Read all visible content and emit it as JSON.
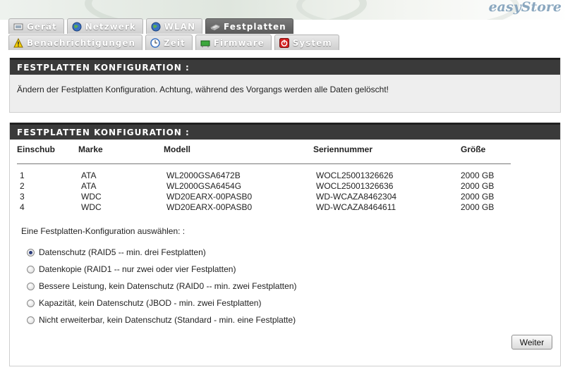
{
  "brand": {
    "logo_text": "easyStore"
  },
  "tabs_row1": [
    {
      "label": "Gerät",
      "icon": "device-icon"
    },
    {
      "label": "Netzwerk",
      "icon": "globe-icon"
    },
    {
      "label": "WLAN",
      "icon": "globe-icon"
    },
    {
      "label": "Festplatten",
      "icon": "disk-icon",
      "active": true
    }
  ],
  "tabs_row2": [
    {
      "label": "Benachrichtigungen",
      "icon": "warning-icon"
    },
    {
      "label": "Zeit",
      "icon": "clock-icon"
    },
    {
      "label": "Firmware",
      "icon": "firmware-icon"
    },
    {
      "label": "System",
      "icon": "power-icon"
    }
  ],
  "section1": {
    "title": "FESTPLATTEN KONFIGURATION :",
    "message": "Ändern der Festplatten Konfiguration. Achtung, während des Vorgangs werden alle Daten gelöscht!"
  },
  "section2": {
    "title": "FESTPLATTEN KONFIGURATION :",
    "columns": [
      "Einschub",
      "Marke",
      "Modell",
      "Seriennummer",
      "Größe"
    ],
    "rows": [
      [
        "1",
        "ATA",
        "WL2000GSA6472B",
        "WOCL25001326626",
        "2000 GB"
      ],
      [
        "2",
        "ATA",
        "WL2000GSA6454G",
        "WOCL25001326636",
        "2000 GB"
      ],
      [
        "3",
        "WDC",
        "WD20EARX-00PASB0",
        "WD-WCAZA8462304",
        "2000 GB"
      ],
      [
        "4",
        "WDC",
        "WD20EARX-00PASB0",
        "WD-WCAZA8464611",
        "2000 GB"
      ]
    ],
    "choose_label": "Eine Festplatten-Konfiguration auswählen: :",
    "options": [
      {
        "label": "Datenschutz (RAID5 -- min. drei Festplatten)",
        "selected": true
      },
      {
        "label": "Datenkopie (RAID1 -- nur zwei oder vier Festplatten)",
        "selected": false
      },
      {
        "label": "Bessere Leistung, kein Datenschutz (RAID0 -- min. zwei Festplatten)",
        "selected": false
      },
      {
        "label": "Kapazität, kein Datenschutz (JBOD - min. zwei Festplatten)",
        "selected": false
      },
      {
        "label": "Nicht erweiterbar, kein Datenschutz (Standard - min. eine Festplatte)",
        "selected": false
      }
    ],
    "next_button": "Weiter"
  }
}
